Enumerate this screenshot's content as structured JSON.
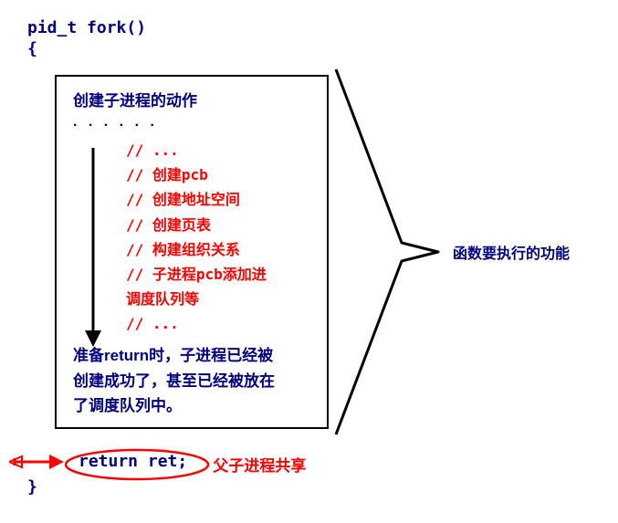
{
  "signature": "pid_t fork()",
  "open_brace": "{",
  "close_brace": "}",
  "box": {
    "title": "创建子进程的动作",
    "dots": ". . . . . .",
    "comments": [
      "// ...",
      "// 创建pcb",
      "// 创建地址空间",
      "// 创建页表",
      "// 构建组织关系",
      "// 子进程pcb添加进",
      "   调度队列等",
      "// ..."
    ],
    "ready_text_l1": "准备return时，子进程已经被",
    "ready_text_l2": "创建成功了，甚至已经被放在",
    "ready_text_l3": "了调度队列中。"
  },
  "right_label": "函数要执行的功能",
  "return_stmt": "return ret;",
  "share_label": "父子进程共享",
  "icons": {
    "down_arrow": "down-arrow-icon",
    "right_brace": "brace-bracket-icon",
    "left_arrow": "left-arrow-icon",
    "oval": "oval-highlight-icon"
  }
}
